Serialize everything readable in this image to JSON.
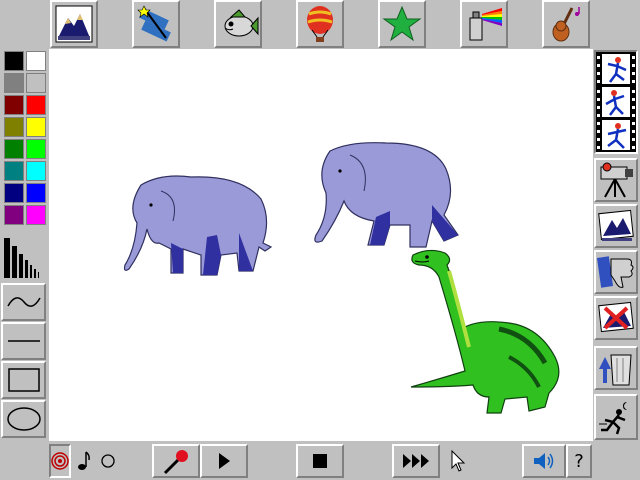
{
  "top_toolbar": [
    {
      "name": "background-scene-button",
      "icon": "mountain-icon"
    },
    {
      "name": "magic-wand-button",
      "icon": "wand-film-icon"
    },
    {
      "name": "fish-stamp-button",
      "icon": "fish-icon"
    },
    {
      "name": "balloon-stamp-button",
      "icon": "hot-air-balloon-icon"
    },
    {
      "name": "star-stamp-button",
      "icon": "star-icon"
    },
    {
      "name": "spray-paint-button",
      "icon": "spray-can-icon"
    },
    {
      "name": "music-button",
      "icon": "violin-icon"
    }
  ],
  "palette": {
    "colors": [
      "#000000",
      "#ffffff",
      "#808080",
      "#c0c0c0",
      "#800000",
      "#ff0000",
      "#808000",
      "#ffff00",
      "#008000",
      "#00ff00",
      "#008080",
      "#00ffff",
      "#000080",
      "#0000ff",
      "#800080",
      "#ff00ff"
    ]
  },
  "right_toolbar": [
    {
      "name": "animation-frames-button",
      "icon": "film-strip-icon"
    },
    {
      "name": "video-camera-button",
      "icon": "video-camera-icon"
    },
    {
      "name": "scene-view-button",
      "icon": "mountain-picture-icon"
    },
    {
      "name": "thumbs-down-button",
      "icon": "thumbs-down-icon"
    },
    {
      "name": "delete-scene-button",
      "icon": "delete-picture-icon"
    },
    {
      "name": "trash-button",
      "icon": "trash-can-icon"
    },
    {
      "name": "exit-button",
      "icon": "running-man-icon"
    }
  ],
  "bottom_toolbar": {
    "help_label": "?"
  }
}
